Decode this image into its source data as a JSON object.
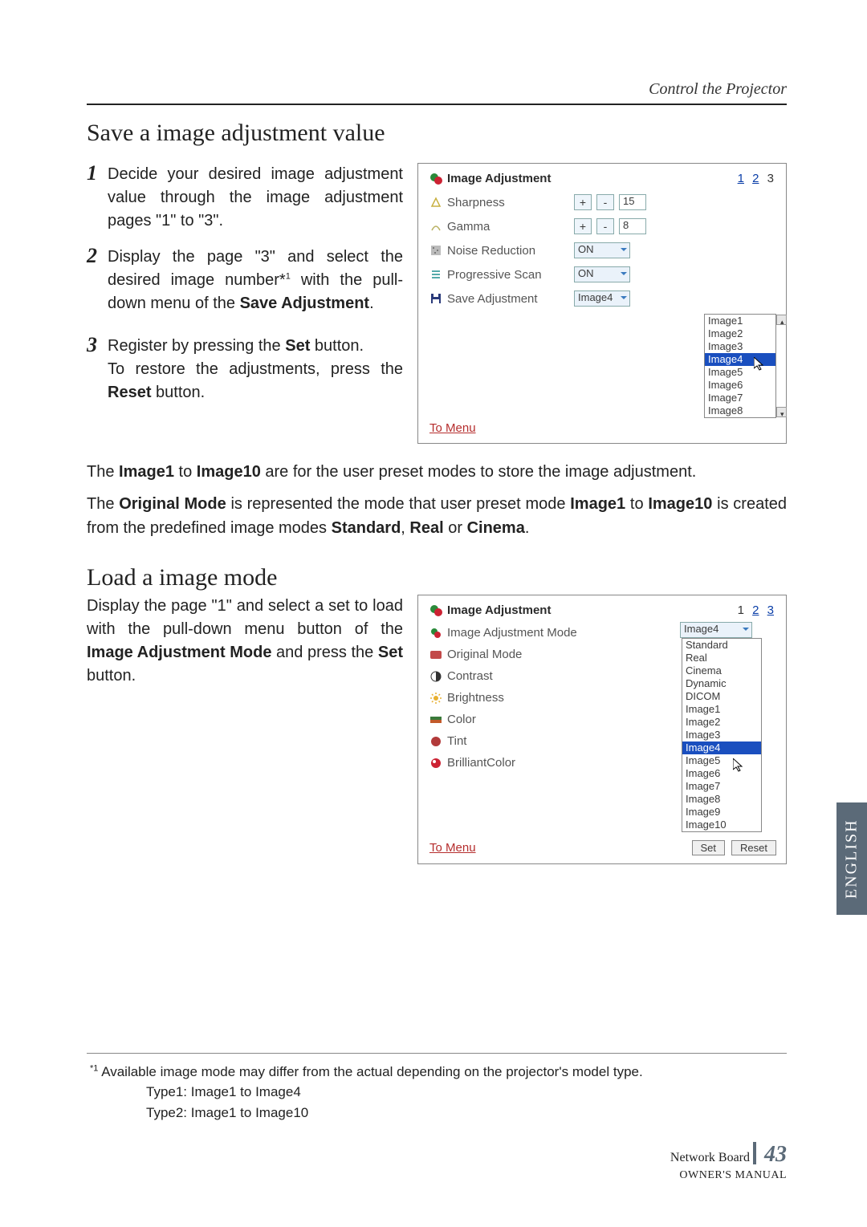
{
  "header": {
    "section": "Control the Projector"
  },
  "section1": {
    "title": "Save a image adjustment value",
    "steps": [
      {
        "n": "1",
        "text_a": "Decide your desired image adjustment value through the image adjustment pages \"1\" to \"3\"."
      },
      {
        "n": "2",
        "text_a": "Display the page \"3\" and select the desired image number*",
        "sup": "1",
        "text_b": " with the pull-down menu of the ",
        "bold": "Save Adjustment",
        "text_c": "."
      },
      {
        "n": "3",
        "text_a": "Register by pressing the ",
        "bold": "Set",
        "text_b": " button.",
        "line2_a": "To restore the adjustments, press the ",
        "line2_bold": "Reset",
        "line2_b": " button."
      }
    ],
    "panel": {
      "title": "Image Adjustment",
      "pages": [
        "1",
        "2",
        "3"
      ],
      "current_page": "3",
      "rows": {
        "sharpness": {
          "label": "Sharpness",
          "value": "15"
        },
        "gamma": {
          "label": "Gamma",
          "value": "8"
        },
        "noise": {
          "label": "Noise Reduction",
          "value": "ON"
        },
        "progressive": {
          "label": "Progressive Scan",
          "value": "ON"
        },
        "save": {
          "label": "Save Adjustment",
          "value": "Image4"
        }
      },
      "dropdown": [
        "Image1",
        "Image2",
        "Image3",
        "Image4",
        "Image5",
        "Image6",
        "Image7",
        "Image8"
      ],
      "dropdown_highlight": "Image4",
      "to_menu": "To Menu"
    }
  },
  "paras": {
    "p1_a": "The ",
    "p1_b1": "Image1",
    "p1_c": " to ",
    "p1_b2": "Image10",
    "p1_d": " are for the user preset modes to store the image adjustment.",
    "p2_a": "The ",
    "p2_b1": "Original Mode",
    "p2_c": " is represented the mode that user preset mode ",
    "p2_b2": "Image1",
    "p2_d": " to ",
    "p2_b3": "Image10",
    "p2_e": " is created from the predefined image modes ",
    "p2_b4": "Standard",
    "p2_f": ", ",
    "p2_b5": "Real",
    "p2_g": " or ",
    "p2_b6": "Cinema",
    "p2_h": "."
  },
  "section2": {
    "title": "Load a image mode",
    "text_a": "Display the page \"1\" and select a set to load with the pull-down menu button of the ",
    "bold1": "Image Adjustment Mode",
    "text_b": " and press the ",
    "bold2": "Set",
    "text_c": " button.",
    "panel": {
      "title": "Image Adjustment",
      "pages": [
        "1",
        "2",
        "3"
      ],
      "current_page": "1",
      "rows": {
        "mode": {
          "label": "Image Adjustment Mode",
          "value": "Image4"
        },
        "original": {
          "label": "Original Mode"
        },
        "contrast": {
          "label": "Contrast"
        },
        "brightness": {
          "label": "Brightness"
        },
        "color": {
          "label": "Color"
        },
        "tint": {
          "label": "Tint"
        },
        "brilliant": {
          "label": "BrilliantColor"
        }
      },
      "dropdown": [
        "Standard",
        "Real",
        "Cinema",
        "Dynamic",
        "DICOM",
        "Image1",
        "Image2",
        "Image3",
        "Image4",
        "Image5",
        "Image6",
        "Image7",
        "Image8",
        "Image9",
        "Image10"
      ],
      "dropdown_highlight": "Image4",
      "to_menu": "To Menu",
      "set": "Set",
      "reset": "Reset"
    }
  },
  "side_tab": "ENGLISH",
  "footnote": {
    "marker": "*1",
    "line1": " Available image mode may differ from the actual depending on the projector's model type.",
    "line2": "Type1: Image1 to Image4",
    "line3": "Type2: Image1 to Image10"
  },
  "footer": {
    "label": "Network Board",
    "page": "43",
    "sub": "OWNER'S MANUAL"
  }
}
